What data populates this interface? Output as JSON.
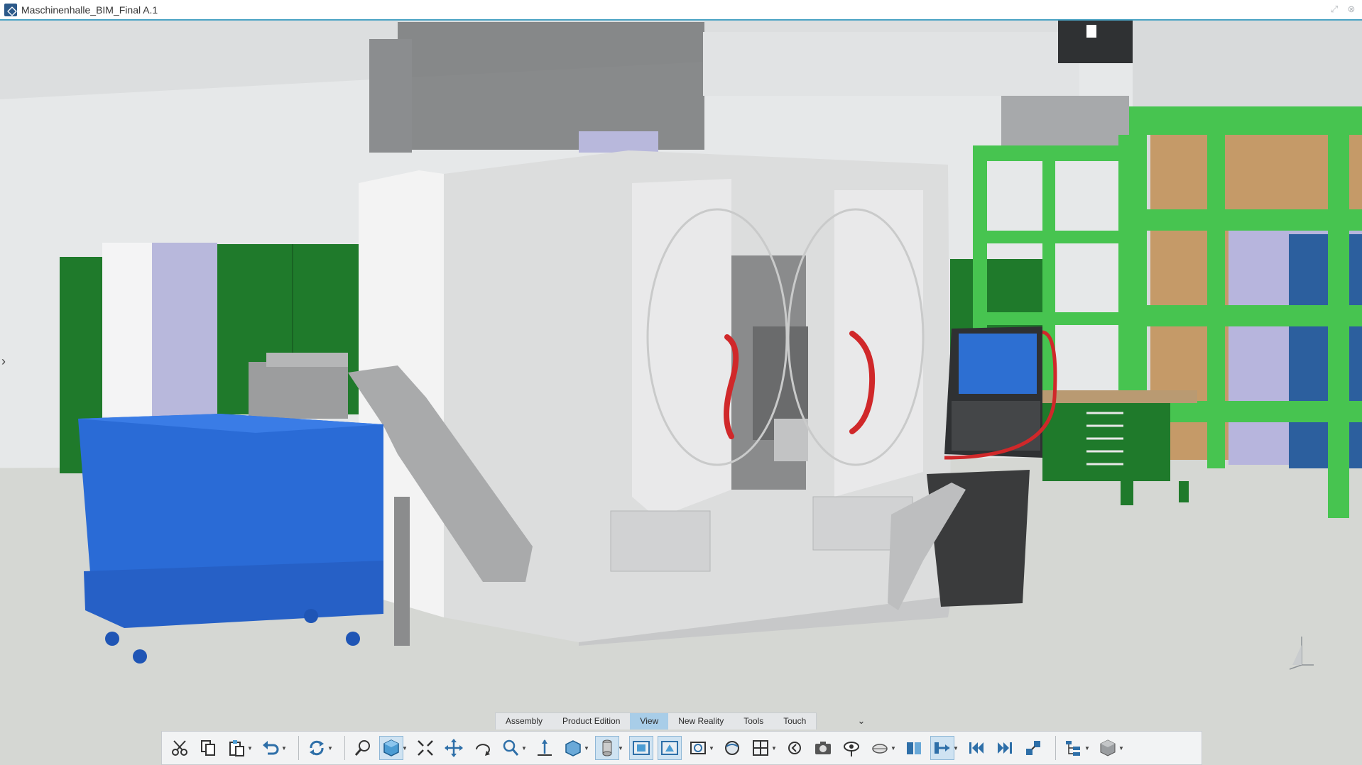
{
  "window": {
    "title": "Maschinenhalle_BIM_Final A.1"
  },
  "command_tabs": [
    {
      "label": "Assembly",
      "active": false
    },
    {
      "label": "Product Edition",
      "active": false
    },
    {
      "label": "View",
      "active": true
    },
    {
      "label": "New Reality",
      "active": false
    },
    {
      "label": "Tools",
      "active": false
    },
    {
      "label": "Touch",
      "active": false
    }
  ],
  "toolbar": {
    "buttons": [
      {
        "icon": "cut-icon"
      },
      {
        "icon": "copy-icon"
      },
      {
        "icon": "paste-icon",
        "dropdown": true
      },
      {
        "icon": "undo-icon",
        "dropdown": true
      },
      {
        "icon": "update-icon",
        "dropdown": true
      },
      {
        "icon": "zoom-fit-icon"
      },
      {
        "icon": "view-cube-icon",
        "dropdown": true,
        "active": true
      },
      {
        "icon": "fit-all-icon"
      },
      {
        "icon": "pan-icon"
      },
      {
        "icon": "rotate-icon"
      },
      {
        "icon": "zoom-icon",
        "dropdown": true
      },
      {
        "icon": "normal-view-icon"
      },
      {
        "icon": "iso-view-icon",
        "dropdown": true
      },
      {
        "icon": "cylinder-icon",
        "dropdown": true,
        "active": true
      },
      {
        "icon": "shading-icon",
        "active": true
      },
      {
        "icon": "shading-edges-icon",
        "active": true
      },
      {
        "icon": "render-icon",
        "dropdown": true
      },
      {
        "icon": "lighting-icon"
      },
      {
        "icon": "multi-view-icon",
        "dropdown": true
      },
      {
        "icon": "previous-icon"
      },
      {
        "icon": "camera-icon"
      },
      {
        "icon": "look-at-icon"
      },
      {
        "icon": "fly-icon",
        "dropdown": true
      },
      {
        "icon": "walk-icon"
      },
      {
        "icon": "navigation-mode-icon",
        "dropdown": true,
        "active": true
      },
      {
        "icon": "first-frame-icon"
      },
      {
        "icon": "last-frame-icon"
      },
      {
        "icon": "explode-icon"
      },
      {
        "icon": "tree-icon",
        "dropdown": true
      },
      {
        "icon": "product-icon",
        "dropdown": true
      }
    ]
  },
  "colors": {
    "title_accent": "#4aa3c4",
    "active_tab": "#a8cde8",
    "machine_body": "#d9dadb",
    "bin_blue": "#2a6bd6",
    "shelf_green": "#47c450",
    "cabinet_green": "#1f7a2b",
    "door_handle_red": "#d0282a",
    "screen_blue": "#2d6fd2"
  }
}
